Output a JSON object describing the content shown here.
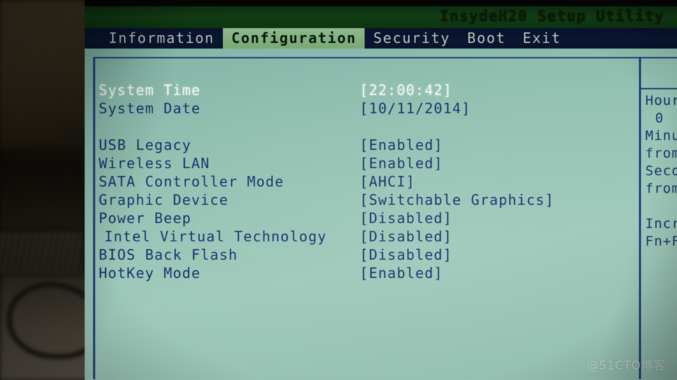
{
  "window": {
    "title": "InsydeH20 Setup Utility"
  },
  "tabs": [
    {
      "label": "Information",
      "active": false
    },
    {
      "label": "Configuration",
      "active": true
    },
    {
      "label": "Security",
      "active": false
    },
    {
      "label": "Boot",
      "active": false
    },
    {
      "label": "Exit",
      "active": false
    }
  ],
  "settings": [
    {
      "label": "System Time",
      "value": "[22:00:42]",
      "selected": true,
      "indent": false
    },
    {
      "label": "System Date",
      "value": "[10/11/2014]",
      "selected": false,
      "indent": false
    },
    {
      "label": "USB Legacy",
      "value": "[Enabled]",
      "selected": false,
      "indent": false
    },
    {
      "label": "Wireless LAN",
      "value": "[Enabled]",
      "selected": false,
      "indent": false
    },
    {
      "label": "SATA Controller Mode",
      "value": "[AHCI]",
      "selected": false,
      "indent": false
    },
    {
      "label": "Graphic Device",
      "value": "[Switchable Graphics]",
      "selected": false,
      "indent": false
    },
    {
      "label": "Power Beep",
      "value": "[Disabled]",
      "selected": false,
      "indent": false
    },
    {
      "label": "Intel Virtual Technology",
      "value": "[Disabled]",
      "selected": false,
      "indent": true
    },
    {
      "label": "BIOS Back Flash",
      "value": "[Disabled]",
      "selected": false,
      "indent": false
    },
    {
      "label": "HotKey Mode",
      "value": "[Enabled]",
      "selected": false,
      "indent": false
    }
  ],
  "help": {
    "lines": [
      {
        "text": "Hour",
        "center": false
      },
      {
        "text": "0",
        "center": true
      },
      {
        "text": "Minu",
        "center": false
      },
      {
        "text": "from",
        "center": false
      },
      {
        "text": "Seco",
        "center": false
      },
      {
        "text": "from",
        "center": false
      },
      {
        "text": "",
        "center": false
      },
      {
        "text": "Incr",
        "center": false
      },
      {
        "text": "Fn+F",
        "center": false
      }
    ]
  },
  "watermark": {
    "text": "@51CTO博客"
  },
  "colors": {
    "screen_background": "#93c3b3",
    "text_primary": "#17306b",
    "text_selected": "#f2f7f4",
    "frame_line": "#1d3f7a",
    "titlebar": "#123e14",
    "tabbar": "#0a1733",
    "tab_active_background": "#8fb98c"
  }
}
